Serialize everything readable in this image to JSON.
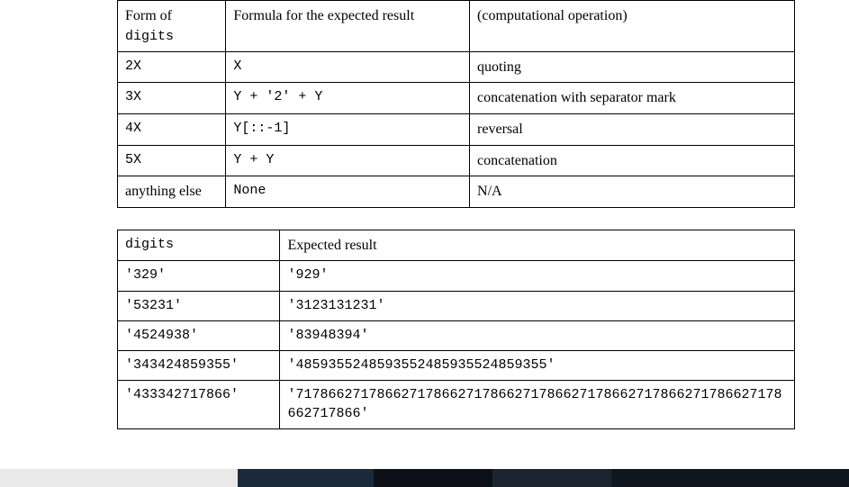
{
  "table1": {
    "header": {
      "col1_line1": "Form of",
      "col1_line2": "digits",
      "col2": "Formula for the expected result",
      "col3": "(computational operation)"
    },
    "rows": [
      {
        "form": "2X",
        "formula": "X",
        "op": "quoting"
      },
      {
        "form": "3X",
        "formula": "Y + '2' + Y",
        "op": "concatenation with separator mark"
      },
      {
        "form": "4X",
        "formula": "Y[::-1]",
        "op": "reversal"
      },
      {
        "form": "5X",
        "formula": "Y + Y",
        "op": "concatenation"
      },
      {
        "form": "anything else",
        "formula": "None",
        "op": "N/A"
      }
    ]
  },
  "table2": {
    "header": {
      "col1": "digits",
      "col2": "Expected result"
    },
    "rows": [
      {
        "digits": "'329'",
        "result": "'929'"
      },
      {
        "digits": "'53231'",
        "result": "'3123131231'"
      },
      {
        "digits": "'4524938'",
        "result": "'83948394'"
      },
      {
        "digits": "'343424859355'",
        "result": "'4859355248593552485935524859355'"
      },
      {
        "digits": "'433342717866'",
        "result": "'717866271786627178662717866271786627178662717866271786627178662717866'"
      }
    ]
  }
}
